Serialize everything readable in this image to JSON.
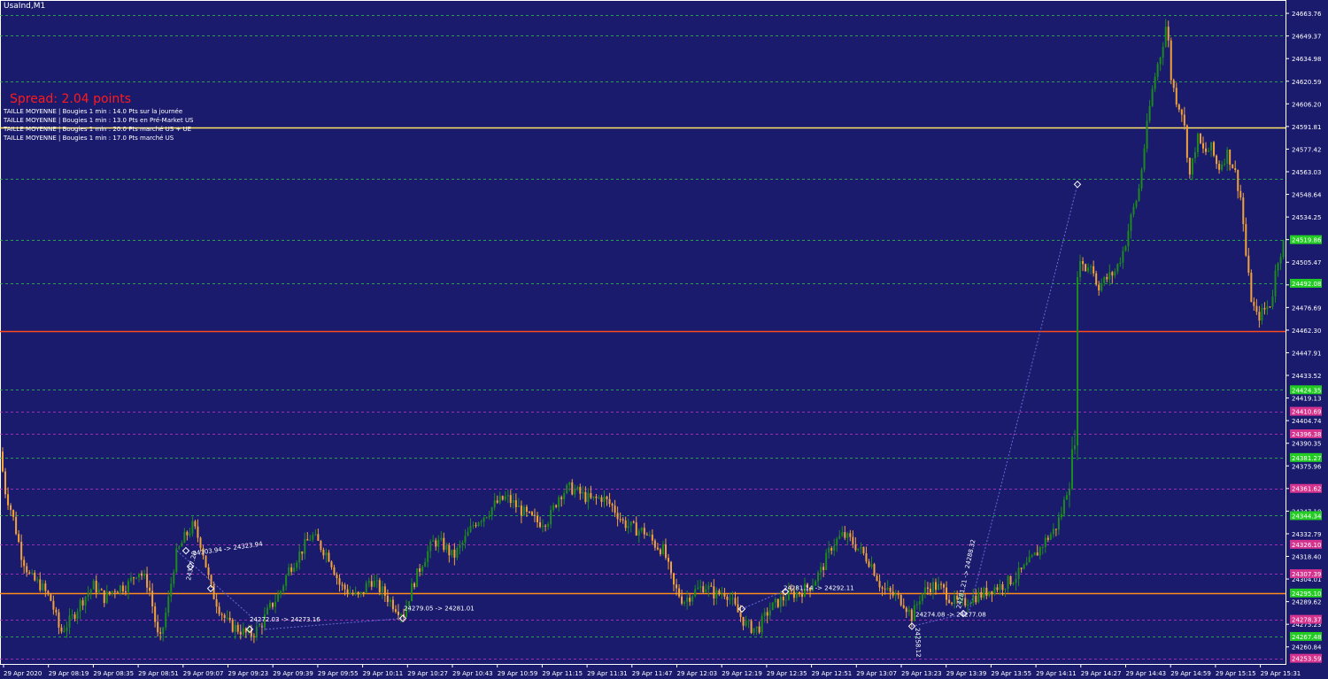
{
  "window": {
    "title": "UsaInd,M1"
  },
  "overlay": {
    "spread": "Spread: 2.04 points",
    "info_lines": [
      "TAILLE MOYENNE | Bougies 1 min : 14.0 Pts sur la journée",
      "TAILLE MOYENNE | Bougies 1 min : 13.0 Pts en Pré-Market US",
      "TAILLE MOYENNE | Bougies 1 min : 20.0 Pts marché US + UE",
      "TAILLE MOYENNE | Bougies 1 min : 17.0 Pts marché US"
    ]
  },
  "colors": {
    "background": "#1b1b6e",
    "bull": "#1c8a1c",
    "bear": "#f2a23a",
    "grid_green": "#2ecc40",
    "grid_magenta": "#cc33cc",
    "line_yellow": "#ffe566",
    "line_red": "#ff4a1a",
    "line_orange": "#ff8c1a",
    "axis_text": "#ffffff"
  },
  "chart_data": {
    "type": "candlestick",
    "symbol": "UsaInd",
    "timeframe": "M1",
    "ylim": [
      24250,
      24670
    ],
    "y_ticks": [
      "24663.76",
      "24649.37",
      "24634.98",
      "24620.59",
      "24606.20",
      "24591.81",
      "24577.42",
      "24563.03",
      "24548.64",
      "24534.25",
      "24519.86",
      "24505.47",
      "24491.08",
      "24476.69",
      "24462.30",
      "24447.91",
      "24433.52",
      "24419.13",
      "24404.74",
      "24390.35",
      "24375.96",
      "24361.57",
      "24347.18",
      "24332.79",
      "24318.40",
      "24304.01",
      "24289.62",
      "24275.23",
      "24260.84"
    ],
    "x_ticks": [
      "29 Apr 2020",
      "29 Apr 08:19",
      "29 Apr 08:35",
      "29 Apr 08:51",
      "29 Apr 09:07",
      "29 Apr 09:23",
      "29 Apr 09:39",
      "29 Apr 09:55",
      "29 Apr 10:11",
      "29 Apr 10:27",
      "29 Apr 10:43",
      "29 Apr 10:59",
      "29 Apr 11:15",
      "29 Apr 11:31",
      "29 Apr 11:47",
      "29 Apr 12:03",
      "29 Apr 12:19",
      "29 Apr 12:35",
      "29 Apr 12:51",
      "29 Apr 13:07",
      "29 Apr 13:23",
      "29 Apr 13:39",
      "29 Apr 13:55",
      "29 Apr 14:11",
      "29 Apr 14:27",
      "29 Apr 14:43",
      "29 Apr 14:59",
      "29 Apr 15:15",
      "29 Apr 15:31"
    ],
    "price_path": [
      [
        0,
        24385
      ],
      [
        6,
        24360
      ],
      [
        14,
        24345
      ],
      [
        24,
        24320
      ],
      [
        34,
        24305
      ],
      [
        46,
        24300
      ],
      [
        58,
        24290
      ],
      [
        68,
        24270
      ],
      [
        80,
        24278
      ],
      [
        92,
        24290
      ],
      [
        106,
        24300
      ],
      [
        118,
        24292
      ],
      [
        130,
        24298
      ],
      [
        144,
        24300
      ],
      [
        156,
        24310
      ],
      [
        168,
        24300
      ],
      [
        180,
        24262
      ],
      [
        190,
        24290
      ],
      [
        198,
        24318
      ],
      [
        208,
        24330
      ],
      [
        218,
        24338
      ],
      [
        228,
        24325
      ],
      [
        238,
        24298
      ],
      [
        248,
        24285
      ],
      [
        258,
        24275
      ],
      [
        270,
        24272
      ],
      [
        282,
        24268
      ],
      [
        294,
        24274
      ],
      [
        304,
        24285
      ],
      [
        316,
        24295
      ],
      [
        326,
        24310
      ],
      [
        338,
        24320
      ],
      [
        352,
        24332
      ],
      [
        362,
        24325
      ],
      [
        372,
        24318
      ],
      [
        384,
        24300
      ],
      [
        394,
        24296
      ],
      [
        406,
        24292
      ],
      [
        418,
        24304
      ],
      [
        432,
        24296
      ],
      [
        444,
        24288
      ],
      [
        456,
        24282
      ],
      [
        466,
        24300
      ],
      [
        478,
        24316
      ],
      [
        490,
        24328
      ],
      [
        500,
        24326
      ],
      [
        512,
        24318
      ],
      [
        524,
        24328
      ],
      [
        536,
        24340
      ],
      [
        548,
        24345
      ],
      [
        560,
        24352
      ],
      [
        572,
        24356
      ],
      [
        584,
        24350
      ],
      [
        596,
        24344
      ],
      [
        608,
        24340
      ],
      [
        620,
        24342
      ],
      [
        632,
        24358
      ],
      [
        644,
        24362
      ],
      [
        656,
        24358
      ],
      [
        668,
        24354
      ],
      [
        680,
        24356
      ],
      [
        692,
        24350
      ],
      [
        704,
        24340
      ],
      [
        716,
        24336
      ],
      [
        728,
        24334
      ],
      [
        740,
        24326
      ],
      [
        750,
        24322
      ],
      [
        760,
        24300
      ],
      [
        772,
        24290
      ],
      [
        784,
        24296
      ],
      [
        796,
        24300
      ],
      [
        808,
        24294
      ],
      [
        820,
        24296
      ],
      [
        832,
        24284
      ],
      [
        844,
        24274
      ],
      [
        856,
        24272
      ],
      [
        868,
        24284
      ],
      [
        880,
        24290
      ],
      [
        892,
        24294
      ],
      [
        904,
        24296
      ],
      [
        916,
        24300
      ],
      [
        928,
        24310
      ],
      [
        940,
        24326
      ],
      [
        952,
        24332
      ],
      [
        962,
        24328
      ],
      [
        972,
        24322
      ],
      [
        984,
        24314
      ],
      [
        996,
        24298
      ],
      [
        1008,
        24294
      ],
      [
        1020,
        24290
      ],
      [
        1030,
        24280
      ],
      [
        1040,
        24294
      ],
      [
        1052,
        24300
      ],
      [
        1064,
        24298
      ],
      [
        1076,
        24290
      ],
      [
        1086,
        24288
      ],
      [
        1096,
        24292
      ],
      [
        1108,
        24294
      ],
      [
        1120,
        24298
      ],
      [
        1132,
        24300
      ],
      [
        1144,
        24304
      ],
      [
        1156,
        24310
      ],
      [
        1168,
        24318
      ],
      [
        1180,
        24328
      ],
      [
        1192,
        24336
      ],
      [
        1200,
        24348
      ],
      [
        1208,
        24368
      ],
      [
        1214,
        24395
      ],
      [
        1218,
        24520
      ],
      [
        1224,
        24500
      ],
      [
        1232,
        24505
      ],
      [
        1240,
        24490
      ],
      [
        1250,
        24495
      ],
      [
        1260,
        24500
      ],
      [
        1270,
        24515
      ],
      [
        1278,
        24535
      ],
      [
        1286,
        24550
      ],
      [
        1294,
        24585
      ],
      [
        1300,
        24610
      ],
      [
        1306,
        24628
      ],
      [
        1312,
        24640
      ],
      [
        1318,
        24660
      ],
      [
        1322,
        24625
      ],
      [
        1328,
        24610
      ],
      [
        1336,
        24600
      ],
      [
        1344,
        24560
      ],
      [
        1352,
        24585
      ],
      [
        1360,
        24575
      ],
      [
        1368,
        24578
      ],
      [
        1376,
        24565
      ],
      [
        1386,
        24575
      ],
      [
        1394,
        24565
      ],
      [
        1402,
        24545
      ],
      [
        1408,
        24505
      ],
      [
        1414,
        24480
      ],
      [
        1420,
        24470
      ],
      [
        1428,
        24475
      ],
      [
        1436,
        24480
      ],
      [
        1442,
        24505
      ],
      [
        1450,
        24518
      ]
    ],
    "h_lines": [
      {
        "price": 24662.5,
        "style": "dash",
        "color": "green",
        "label": "",
        "box": ""
      },
      {
        "price": 24649.6,
        "style": "dash",
        "color": "green",
        "label": "",
        "box": ""
      },
      {
        "price": 24620.7,
        "style": "dash",
        "color": "green",
        "label": "",
        "box": ""
      },
      {
        "price": 24591.3,
        "style": "solid",
        "color": "yellow",
        "label": "",
        "box": ""
      },
      {
        "price": 24558.8,
        "style": "dash",
        "color": "green",
        "label": "",
        "box": ""
      },
      {
        "price": 24519.86,
        "style": "dash",
        "color": "green",
        "label": "24519.86",
        "box": "green"
      },
      {
        "price": 24492.08,
        "style": "dash",
        "color": "green",
        "label": "24492.08",
        "box": "green"
      },
      {
        "price": 24461.8,
        "style": "solid",
        "color": "red",
        "label": "",
        "box": ""
      },
      {
        "price": 24424.35,
        "style": "dash",
        "color": "green",
        "label": "24424.35",
        "box": "green"
      },
      {
        "price": 24410.69,
        "style": "dash",
        "color": "magenta",
        "label": "24410.69",
        "box": "magenta"
      },
      {
        "price": 24396.38,
        "style": "dash",
        "color": "magenta",
        "label": "24396.38",
        "box": "magenta"
      },
      {
        "price": 24381.27,
        "style": "dash",
        "color": "green",
        "label": "24381.27",
        "box": "green"
      },
      {
        "price": 24361.62,
        "style": "dash",
        "color": "magenta",
        "label": "24361.62",
        "box": "magenta"
      },
      {
        "price": 24344.34,
        "style": "dash",
        "color": "green",
        "label": "24344.34",
        "box": "green"
      },
      {
        "price": 24326.1,
        "style": "dash",
        "color": "magenta",
        "label": "24326.10",
        "box": "magenta"
      },
      {
        "price": 24307.39,
        "style": "dash",
        "color": "magenta",
        "label": "24307.39",
        "box": "magenta"
      },
      {
        "price": 24295.1,
        "style": "solid",
        "color": "orange",
        "label": "24295.10",
        "box": "green"
      },
      {
        "price": 24278.37,
        "style": "dash",
        "color": "magenta",
        "label": "24278.37",
        "box": "magenta"
      },
      {
        "price": 24267.48,
        "style": "dash",
        "color": "green",
        "label": "24267.48",
        "box": "green"
      },
      {
        "price": 24253.59,
        "style": "dash",
        "color": "magenta",
        "label": "24253.59",
        "box": "magenta"
      }
    ],
    "annotations": [
      {
        "text": "24303.94 -> 24323.94",
        "x": 218,
        "price": 24319,
        "angle": -8
      },
      {
        "text": "24317.28",
        "x": 215,
        "price": 24303,
        "angle": -78
      },
      {
        "text": "24272.03 -> 24273.16",
        "x": 282,
        "price": 24277,
        "angle": 0
      },
      {
        "text": "24279.05 -> 24281.01",
        "x": 456,
        "price": 24284,
        "angle": 0
      },
      {
        "text": "24281.14 -> 24292.11",
        "x": 885,
        "price": 24297,
        "angle": 0
      },
      {
        "text": "24274.08 -> 24277.08",
        "x": 1034,
        "price": 24280,
        "angle": 0
      },
      {
        "text": "24258.12",
        "x": 1034,
        "price": 24273,
        "angle": 88
      },
      {
        "text": "24281.21 -> 24288.32",
        "x": 1085,
        "price": 24285,
        "angle": -78
      }
    ]
  }
}
